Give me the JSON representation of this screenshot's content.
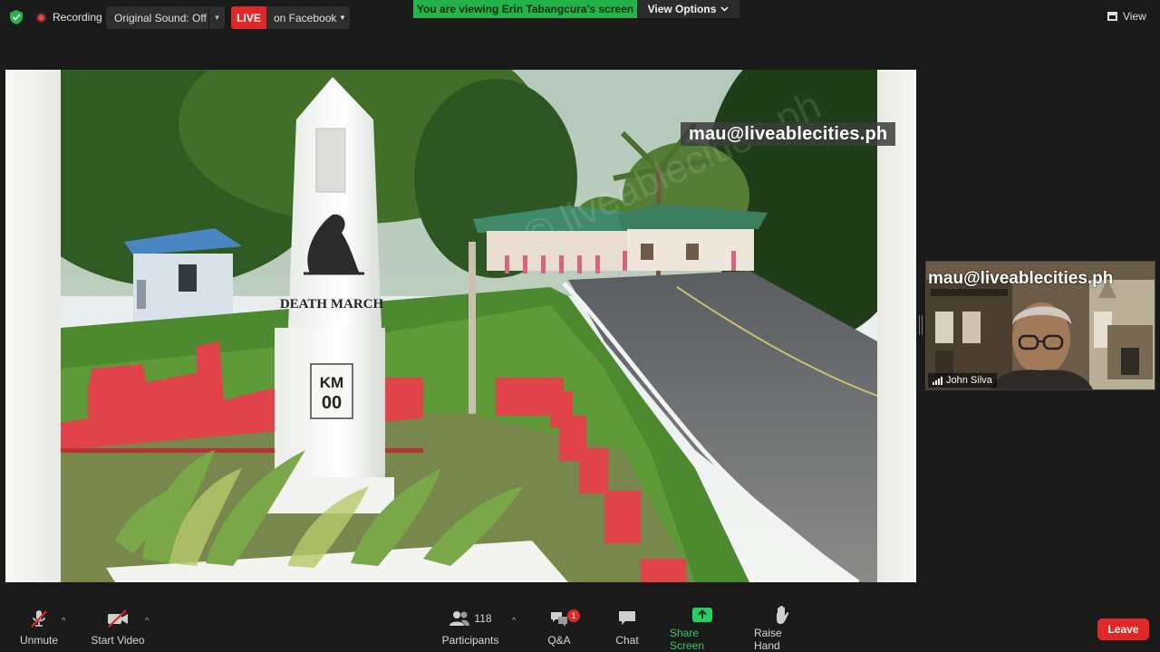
{
  "topbar": {
    "recording_label": "Recording",
    "sound_label": "Original Sound: Off",
    "live_badge": "LIVE",
    "live_target": "on Facebook",
    "viewing_banner": "You are viewing Erin Tabangcura's screen",
    "view_options_label": "View Options",
    "view_label": "View"
  },
  "share": {
    "watermark": "mau@liveablecities.ph",
    "marker_text_1": "DEATH MARCH",
    "marker_text_2": "KM",
    "marker_text_3": "00"
  },
  "participant_tile": {
    "watermark": "mau@liveablecities.ph",
    "name": "John Silva"
  },
  "toolbar": {
    "unmute_label": "Unmute",
    "start_video_label": "Start Video",
    "participants_label": "Participants",
    "participants_count": "118",
    "qa_label": "Q&A",
    "qa_badge": "1",
    "chat_label": "Chat",
    "share_screen_label": "Share Screen",
    "raise_hand_label": "Raise Hand",
    "leave_label": "Leave"
  },
  "colors": {
    "live_red": "#e02828",
    "viewing_green": "#23b34a",
    "share_green": "#23d160",
    "toolbar_bg": "#1a1a1a"
  }
}
